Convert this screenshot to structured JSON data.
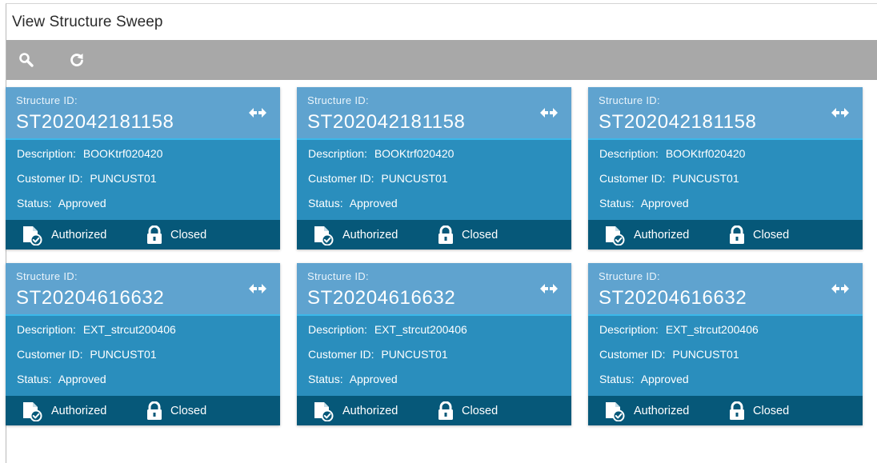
{
  "page": {
    "title": "View Structure Sweep"
  },
  "toolbar": {
    "search_icon": "search-icon",
    "refresh_icon": "refresh-icon"
  },
  "labels": {
    "structure_id": "Structure ID:",
    "description": "Description:",
    "customer_id": "Customer ID:",
    "status": "Status:"
  },
  "cards": [
    {
      "structure_id": "ST202042181158",
      "description": "BOOKtrf020420",
      "customer_id": "PUNCUST01",
      "status": "Approved",
      "auth": "Authorized",
      "lock": "Closed"
    },
    {
      "structure_id": "ST202042181158",
      "description": "BOOKtrf020420",
      "customer_id": "PUNCUST01",
      "status": "Approved",
      "auth": "Authorized",
      "lock": "Closed"
    },
    {
      "structure_id": "ST202042181158",
      "description": "BOOKtrf020420",
      "customer_id": "PUNCUST01",
      "status": "Approved",
      "auth": "Authorized",
      "lock": "Closed"
    },
    {
      "structure_id": "ST20204616632",
      "description": "EXT_strcut200406",
      "customer_id": "PUNCUST01",
      "status": "Approved",
      "auth": "Authorized",
      "lock": "Closed"
    },
    {
      "structure_id": "ST20204616632",
      "description": "EXT_strcut200406",
      "customer_id": "PUNCUST01",
      "status": "Approved",
      "auth": "Authorized",
      "lock": "Closed"
    },
    {
      "structure_id": "ST20204616632",
      "description": "EXT_strcut200406",
      "customer_id": "PUNCUST01",
      "status": "Approved",
      "auth": "Authorized",
      "lock": "Closed"
    }
  ],
  "colors": {
    "toolbar": "#a8a8a8",
    "card_header": "#5fa3cf",
    "card_body": "#2a8ebd",
    "card_footer": "#065879",
    "accent_line": "#3bb8ea"
  }
}
